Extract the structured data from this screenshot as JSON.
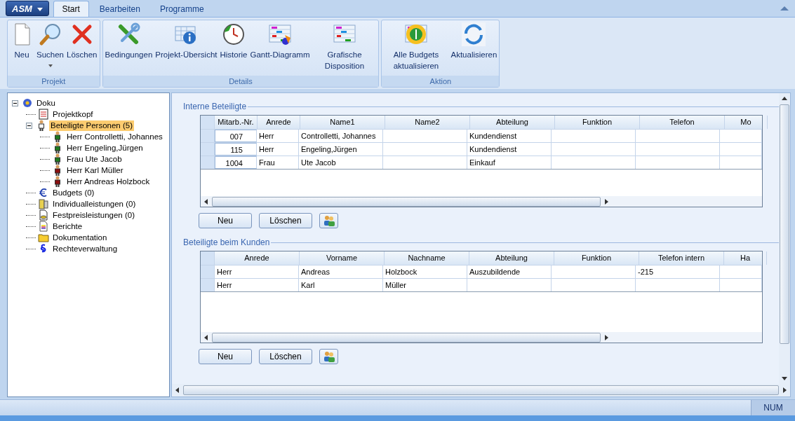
{
  "app_menu": {
    "label": "ASM"
  },
  "tabs": [
    {
      "label": "Start",
      "selected": true
    },
    {
      "label": "Bearbeiten",
      "selected": false
    },
    {
      "label": "Programme",
      "selected": false
    }
  ],
  "ribbon": [
    {
      "caption": "Projekt",
      "buttons": [
        {
          "kind": "new",
          "label": "Neu"
        },
        {
          "kind": "search",
          "label": "Suchen",
          "dropdown": true
        },
        {
          "kind": "delete",
          "label": "Löschen"
        }
      ]
    },
    {
      "caption": "Details",
      "buttons": [
        {
          "kind": "tools",
          "label": "Bedingungen"
        },
        {
          "kind": "info",
          "label": "Projekt-Übersicht"
        },
        {
          "kind": "history",
          "label": "Historie"
        },
        {
          "kind": "gantt",
          "label": "Gantt-Diagramm"
        },
        {
          "kind": "chart",
          "label": "Grafische Disposition"
        }
      ]
    },
    {
      "caption": "Aktion",
      "buttons": [
        {
          "kind": "budget",
          "label": "Alle Budgets aktualisieren"
        },
        {
          "kind": "refresh",
          "label": "Aktualisieren"
        }
      ]
    }
  ],
  "tree": [
    {
      "kind": "root",
      "label": "Doku",
      "expanded": true,
      "selected": false,
      "children": [
        {
          "kind": "document",
          "label": "Projektkopf",
          "selected": false
        },
        {
          "kind": "person",
          "label": "Beteiligte Personen (5)",
          "expanded": true,
          "selected": true,
          "children": [
            {
              "kind": "person",
              "label": "Herr Controlletti, Johannes",
              "color": "#1e7a1e",
              "selected": false
            },
            {
              "kind": "person",
              "label": "Herr Engeling,Jürgen",
              "color": "#1e7a1e",
              "selected": false
            },
            {
              "kind": "person",
              "label": "Frau Ute Jacob",
              "color": "#1e7a1e",
              "selected": false
            },
            {
              "kind": "person",
              "label": "Herr Karl Müller",
              "color": "#8b1010",
              "selected": false
            },
            {
              "kind": "person",
              "label": "Herr Andreas Holzbock",
              "color": "#8b1010",
              "selected": false
            }
          ]
        },
        {
          "kind": "euro",
          "label": "Budgets (0)",
          "selected": false
        },
        {
          "kind": "calc",
          "label": "Individualleistungen (0)",
          "selected": false
        },
        {
          "kind": "coins",
          "label": "Festpreisleistungen (0)",
          "selected": false
        },
        {
          "kind": "report",
          "label": "Berichte",
          "selected": false
        },
        {
          "kind": "folder",
          "label": "Dokumentation",
          "selected": false
        },
        {
          "kind": "paragraph",
          "label": "Rechteverwaltung",
          "selected": false
        }
      ]
    }
  ],
  "sections": [
    {
      "title": "Interne Beteiligte",
      "columns": [
        {
          "label": "Mitarb.-Nr."
        },
        {
          "label": "Anrede"
        },
        {
          "label": "Name1"
        },
        {
          "label": "Name2"
        },
        {
          "label": "Abteilung"
        },
        {
          "label": "Funktion"
        },
        {
          "label": "Telefon"
        },
        {
          "label": "Mo"
        }
      ],
      "rows": [
        [
          "007",
          "Herr",
          "Controlletti, Johannes",
          "",
          "Kundendienst",
          "",
          "",
          ""
        ],
        [
          "115",
          "Herr",
          "Engeling,Jürgen",
          "",
          "Kundendienst",
          "",
          "",
          ""
        ],
        [
          "1004",
          "Frau",
          "Ute Jacob",
          "",
          "Einkauf",
          "",
          "",
          ""
        ]
      ],
      "buttons": [
        "Neu",
        "Löschen"
      ]
    },
    {
      "title": "Beteiligte beim Kunden",
      "columns": [
        {
          "label": "Anrede"
        },
        {
          "label": "Vorname"
        },
        {
          "label": "Nachname"
        },
        {
          "label": "Abteilung"
        },
        {
          "label": "Funktion"
        },
        {
          "label": "Telefon intern"
        },
        {
          "label": "Ha"
        }
      ],
      "rows": [
        [
          "Herr",
          "Andreas",
          "Holzbock",
          "Auszubildende",
          "",
          "-215",
          ""
        ],
        [
          "Herr",
          "Karl",
          "Müller",
          "",
          "",
          "",
          ""
        ]
      ],
      "buttons": [
        "Neu",
        "Löschen"
      ]
    }
  ],
  "status_bar": {
    "indicator": "NUM"
  }
}
